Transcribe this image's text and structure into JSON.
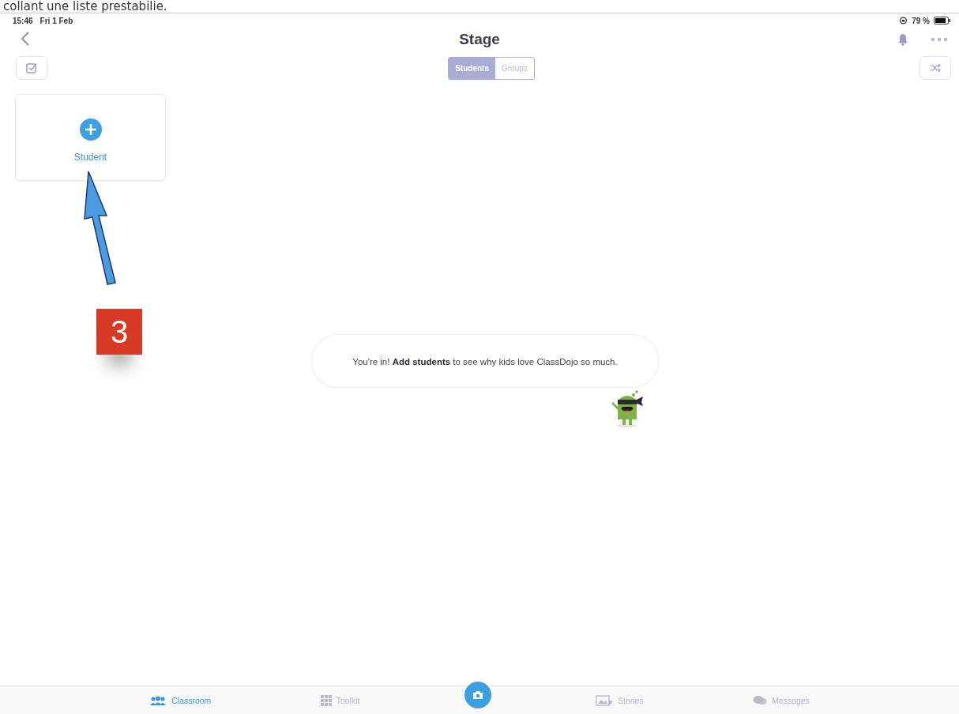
{
  "caption": "collant une liste prestabilie.",
  "status_bar": {
    "time": "15:46",
    "date": "Fri 1 Feb",
    "battery": "79 %"
  },
  "nav": {
    "title": "Stage"
  },
  "segments": [
    {
      "label": "Students",
      "selected": true
    },
    {
      "label": "Groups",
      "selected": false
    }
  ],
  "add_card": {
    "label": "Student"
  },
  "annotation": {
    "step": "3"
  },
  "message": "You're in! **Add students** to see why kids love ClassDojo so much.",
  "tabs": [
    {
      "label": "Classroom",
      "kind": "classroom",
      "selected": true
    },
    {
      "label": "Toolkit",
      "kind": "toolkit",
      "selected": false
    },
    {
      "kind": "camera",
      "selected": false
    },
    {
      "label": "Stories",
      "kind": "stories",
      "selected": false
    },
    {
      "label": "Messages",
      "kind": "messages",
      "selected": false
    }
  ]
}
